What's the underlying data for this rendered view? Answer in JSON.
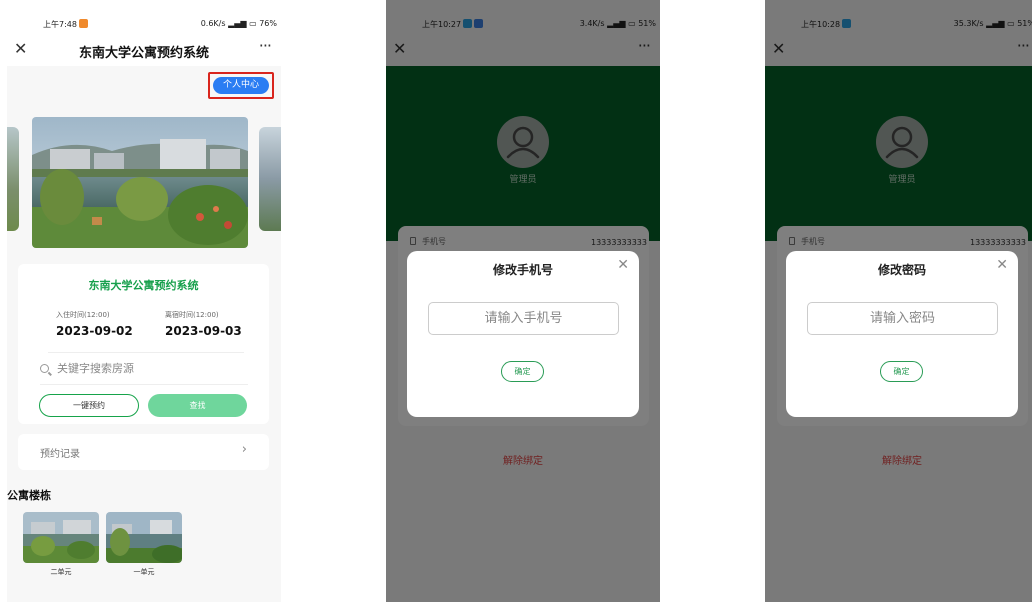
{
  "colors": {
    "accent_green": "#17a04c",
    "header_green": "#046129",
    "blue_button": "#2a7df3",
    "highlight_red": "#d9251d",
    "danger_red": "#e04343"
  },
  "screens": [
    {
      "status": {
        "time": "上午7:48",
        "speed": "0.6K/s",
        "battery": "76%"
      },
      "nav": {
        "close": "✕",
        "title": "东南大学公寓预约系统",
        "more": "···"
      },
      "personal_center": "个人中心",
      "card": {
        "title": "东南大学公寓预约系统",
        "checkin_label": "入住时间(12:00)",
        "checkin_date": "2023-09-02",
        "checkout_label": "离宿时间(12:00)",
        "checkout_date": "2023-09-03",
        "search_placeholder": "关键字搜索房源",
        "one_click": "一键预约",
        "find": "查找"
      },
      "records": {
        "label": "预约记录",
        "arrow": "›"
      },
      "buildings": {
        "title": "公寓楼栋",
        "items": [
          "二单元",
          "一单元"
        ]
      }
    },
    {
      "status": {
        "time": "上午10:27",
        "speed": "3.4K/s",
        "battery": "51%"
      },
      "nav": {
        "close": "✕",
        "more": "···"
      },
      "user_role": "管理员",
      "phone_label": "手机号",
      "phone_value": "13333333333",
      "unbind": "解除绑定",
      "modal": {
        "title": "修改手机号",
        "close": "✕",
        "placeholder": "请输入手机号",
        "confirm": "确定"
      }
    },
    {
      "status": {
        "time": "上午10:28",
        "speed": "35.3K/s",
        "battery": "51%"
      },
      "nav": {
        "close": "✕",
        "more": "···"
      },
      "user_role": "管理员",
      "phone_label": "手机号",
      "phone_value": "13333333333",
      "unbind": "解除绑定",
      "modal": {
        "title": "修改密码",
        "close": "✕",
        "placeholder": "请输入密码",
        "confirm": "确定"
      }
    }
  ]
}
